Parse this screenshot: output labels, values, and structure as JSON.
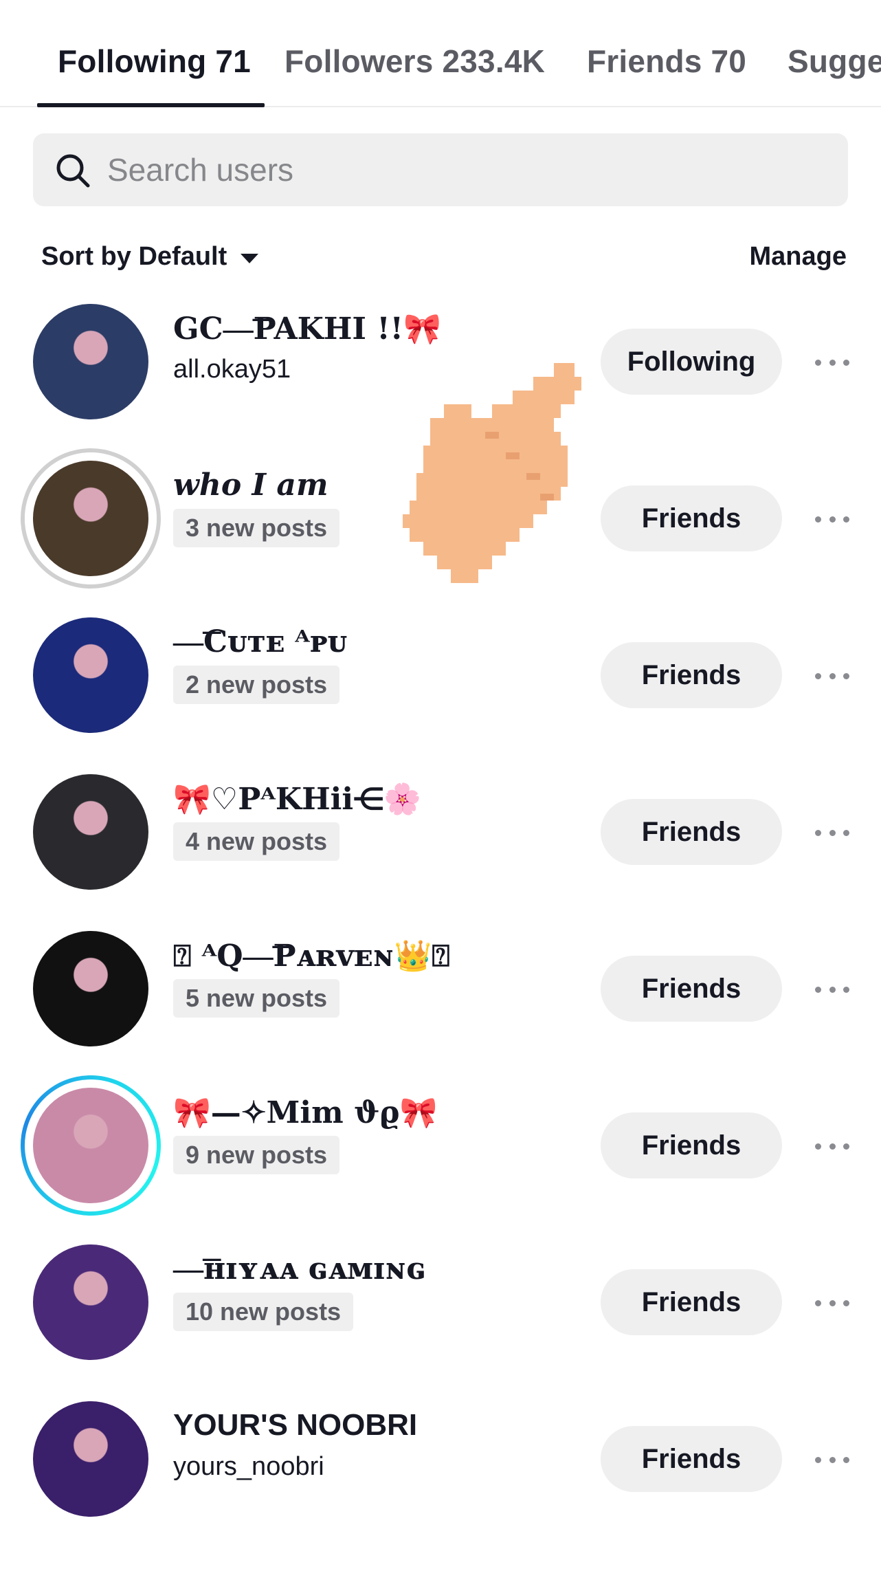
{
  "tabs": [
    {
      "label": "Following 71",
      "active": true
    },
    {
      "label": "Followers 233.4K",
      "active": false
    },
    {
      "label": "Friends 70",
      "active": false
    },
    {
      "label": "Sugge",
      "active": false
    }
  ],
  "search": {
    "placeholder": "Search users",
    "icon": "search-icon"
  },
  "sort": {
    "label": "Sort by Default",
    "icon": "caret-down-icon"
  },
  "manage_label": "Manage",
  "users": [
    {
      "name": "GC—͞PAKHI  !!🎀",
      "sub": "all.okay51",
      "sub_type": "handle",
      "button": "Following",
      "ring": "none",
      "avatar_color": "#2b3c66"
    },
    {
      "name": "who I am",
      "sub": "3 new posts",
      "sub_type": "badge",
      "button": "Friends",
      "ring": "gray",
      "avatar_color": "#4a3a2a"
    },
    {
      "name": "—͞Cᴜᴛᴇ ᴬᴘᴜ",
      "sub": "2 new posts",
      "sub_type": "badge",
      "button": "Friends",
      "ring": "none",
      "avatar_color": "#1b2a7a"
    },
    {
      "name": "🎀♡PᴬKHii⋲🌸",
      "sub": "4 new posts",
      "sub_type": "badge",
      "button": "Friends",
      "ring": "none",
      "avatar_color": "#2a2a2e"
    },
    {
      "name": "⍰ ᴬQ—͞Pᴀʀᴠᴇɴ👑⍰",
      "sub": "5 new posts",
      "sub_type": "badge",
      "button": "Friends",
      "ring": "none",
      "avatar_color": "#111111"
    },
    {
      "name": "🎀—✧Mim ϑϱ🎀",
      "sub": "9 new posts",
      "sub_type": "badge",
      "button": "Friends",
      "ring": "blue",
      "avatar_color": "#c98aa8"
    },
    {
      "name": "—͞ʜɪʏᴀᴀ  ɢᴀᴍɪɴɢ",
      "sub": "10 new posts",
      "sub_type": "badge",
      "button": "Friends",
      "ring": "none",
      "avatar_color": "#4a2a78"
    },
    {
      "name": "YOUR'S NOOBRI ",
      "sub": "yours_noobri",
      "sub_type": "handle",
      "button": "Friends",
      "ring": "none",
      "avatar_color": "#3a1f6a"
    }
  ],
  "colors": {
    "text": "#161823",
    "muted": "#5b5c63",
    "pill_bg": "#efefef",
    "accent_ring": "#20d5ec",
    "hand": "#f6b98a"
  }
}
